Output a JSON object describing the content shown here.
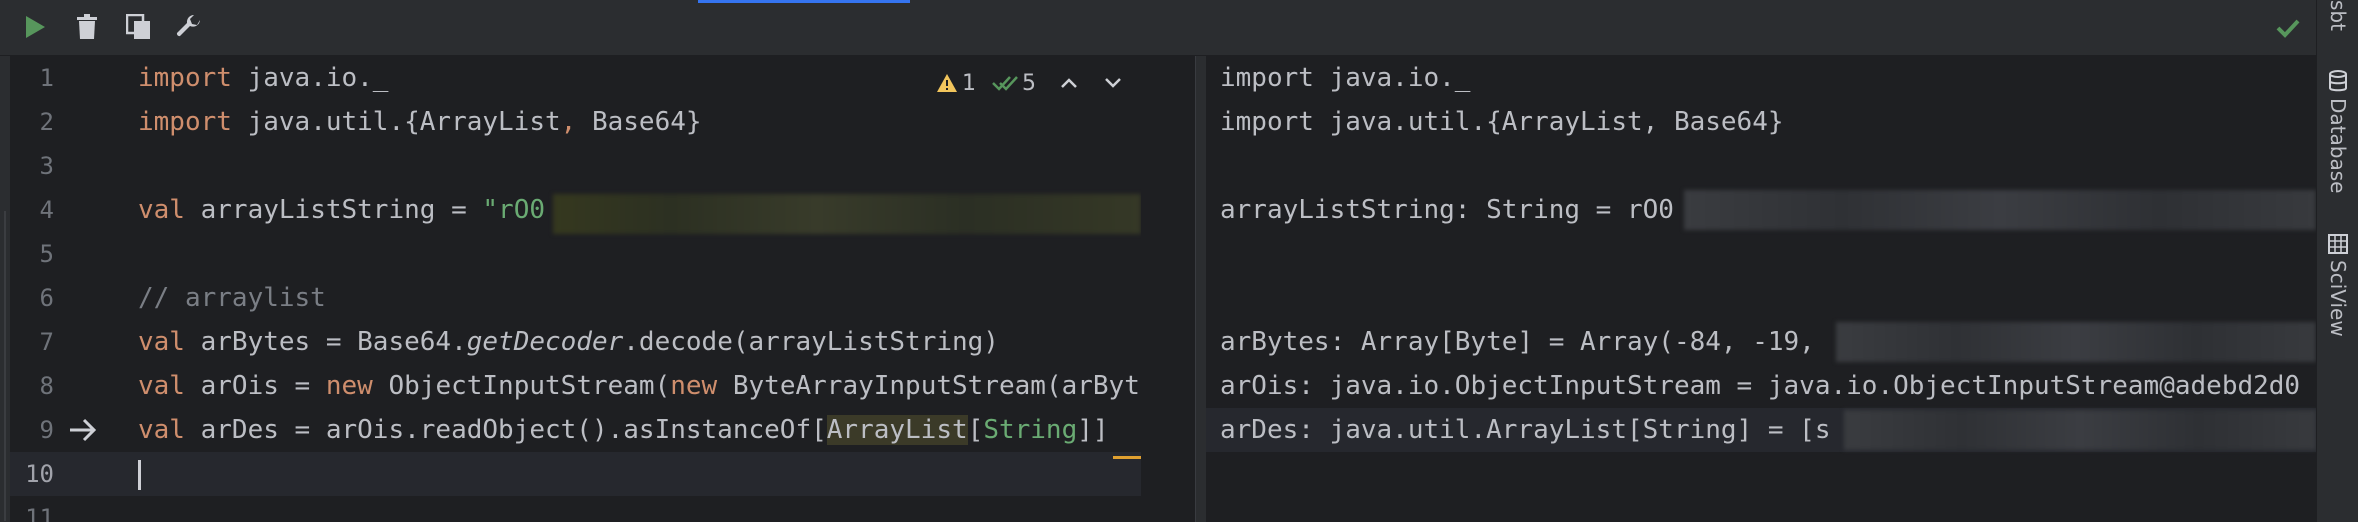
{
  "toolbar": {
    "run": "run-icon",
    "clear": "trash-icon",
    "copy": "copy-icon",
    "settings": "wrench-icon",
    "status": "check-icon"
  },
  "inspections": {
    "warnings": "1",
    "weak_warnings": "5"
  },
  "side_tabs": {
    "sbt": "sbt",
    "database": "Database",
    "sciview": "SciView"
  },
  "editor": {
    "line_numbers": [
      "1",
      "2",
      "3",
      "4",
      "5",
      "6",
      "7",
      "8",
      "9",
      "10",
      "11"
    ],
    "current_line": "10",
    "execution_line": "9"
  },
  "output": {
    "l1": "import java.io._",
    "l2": "import java.util.{ArrayList, Base64}",
    "l4": "arrayListString: String = rO0",
    "l7": "arBytes: Array[Byte] = Array(-84, -19, ",
    "l8": "arOis: java.io.ObjectInputStream = java.io.ObjectInputStream@adebd2d0",
    "l9": "arDes: java.util.ArrayList[String] = [s"
  }
}
